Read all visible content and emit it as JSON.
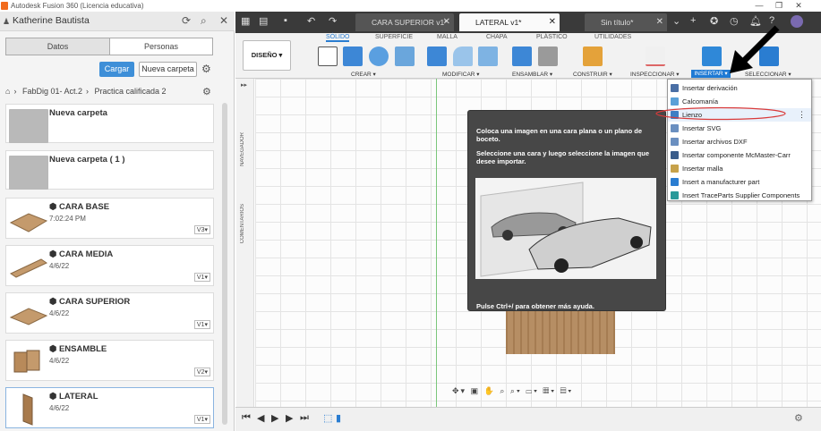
{
  "window": {
    "title": "Autodesk Fusion 360 (Licencia educativa)",
    "controls": [
      "—",
      "❐",
      "✕"
    ]
  },
  "left_panel": {
    "user": "Katherine Bautista",
    "tabs": [
      "Datos",
      "Personas"
    ],
    "upload_label": "Cargar",
    "new_folder_label": "Nueva carpeta",
    "breadcrumb": [
      "FabDig 01- Act.2",
      "Practica calificada 2"
    ],
    "items": [
      {
        "name": "Nueva carpeta",
        "sub": "",
        "version": ""
      },
      {
        "name": "Nueva carpeta ( 1 )",
        "sub": "",
        "version": ""
      },
      {
        "name": "CARA BASE",
        "sub": "7:02:24 PM",
        "version": "V3▾"
      },
      {
        "name": "CARA MEDIA",
        "sub": "4/6/22",
        "version": "V1▾"
      },
      {
        "name": "CARA SUPERIOR",
        "sub": "4/6/22",
        "version": "V1▾"
      },
      {
        "name": "ENSAMBLE",
        "sub": "4/6/22",
        "version": "V2▾"
      },
      {
        "name": "LATERAL",
        "sub": "4/6/22",
        "version": "V1▾"
      }
    ]
  },
  "doc_tabs": [
    {
      "label": "CARA SUPERIOR v1*",
      "active": false
    },
    {
      "label": "LATERAL v1*",
      "active": true
    },
    {
      "label": "Sin título*",
      "active": false
    }
  ],
  "ribbon": {
    "workspace": "DISEÑO ▾",
    "tabs": [
      "SÓLIDO",
      "SUPERFICIE",
      "MALLA",
      "CHAPA",
      "PLÁSTICO",
      "UTILIDADES"
    ],
    "groups": [
      "CREAR ▾",
      "MODIFICAR ▾",
      "ENSAMBLAR ▾",
      "CONSTRUIR ▾",
      "INSPECCIONAR ▾",
      "INSERTAR ▾",
      "SELECCIONAR ▾"
    ]
  },
  "side_labels": {
    "navigator": "NAVEGADOR",
    "comments": "COMENTARIOS"
  },
  "tooltip": {
    "text1": "Coloca una imagen en una cara plana o un plano de boceto.",
    "text2": "Seleccione una cara y luego seleccione la imagen que desee importar.",
    "help": "Pulse Ctrl+/ para obtener más ayuda."
  },
  "insert_menu": [
    {
      "label": "Insertar derivación",
      "icon": "derive-icon",
      "color": "#4a6fa5"
    },
    {
      "label": "Calcomanía",
      "icon": "decal-icon",
      "color": "#5aa0d8"
    },
    {
      "label": "Lienzo",
      "icon": "canvas-icon",
      "color": "#3d7fc4"
    },
    {
      "label": "Insertar SVG",
      "icon": "svg-icon",
      "color": "#6a8fc0"
    },
    {
      "label": "Insertar archivos DXF",
      "icon": "dxf-icon",
      "color": "#6a8fc0"
    },
    {
      "label": "Insertar componente McMaster-Carr",
      "icon": "mcmaster-icon",
      "color": "#3b5d8a"
    },
    {
      "label": "Insertar malla",
      "icon": "mesh-icon",
      "color": "#c7a24a"
    },
    {
      "label": "Insert a manufacturer part",
      "icon": "manufacturer-icon",
      "color": "#2a7dd1"
    },
    {
      "label": "Insert TraceParts Supplier Components",
      "icon": "traceparts-icon",
      "color": "#2a9a9a"
    }
  ],
  "colors": {
    "accent": "#2a7dd1",
    "highlight": "#d93a3a",
    "wood": "#b0875e"
  }
}
